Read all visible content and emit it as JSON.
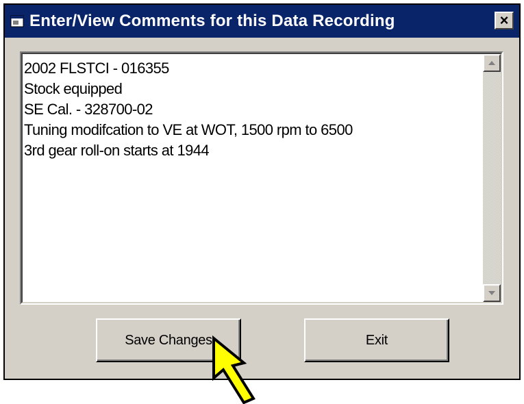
{
  "window": {
    "title": "Enter/View Comments for this Data Recording",
    "close_label": "×"
  },
  "comments": {
    "lines": [
      "2002 FLSTCI - 016355",
      "Stock equipped",
      "SE Cal. - 328700-02",
      "Tuning modifcation to VE at WOT, 1500 rpm to 6500",
      "3rd gear roll-on starts at 1944"
    ]
  },
  "buttons": {
    "save_label": "Save Changes",
    "exit_label": "Exit"
  },
  "icons": {
    "title_icon": "window-app-icon",
    "pointer": "yellow-arrow-icon"
  },
  "colors": {
    "titlebar": "#0a246a",
    "dialog_face": "#d4d0c8",
    "arrow_fill": "#ffff00"
  }
}
